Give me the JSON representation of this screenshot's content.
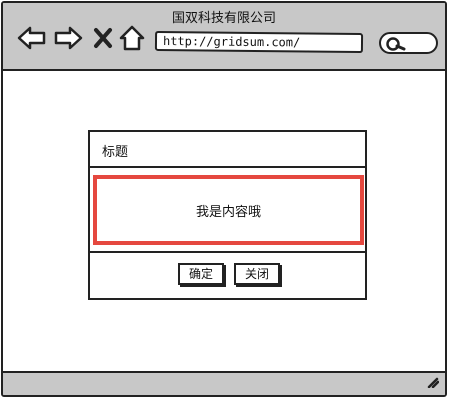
{
  "window": {
    "title": "国双科技有限公司",
    "address": "http://gridsum.com/"
  },
  "icons": {
    "back": "back-arrow-icon",
    "forward": "forward-arrow-icon",
    "stop": "close-x-icon",
    "home": "home-icon",
    "search": "search-icon",
    "resize": "resize-grip-icon"
  },
  "dialog": {
    "title": "标题",
    "content": "我是内容哦",
    "ok_label": "确定",
    "close_label": "关闭"
  },
  "colors": {
    "chrome": "#c8c8c8",
    "content_border": "#e5483f"
  }
}
